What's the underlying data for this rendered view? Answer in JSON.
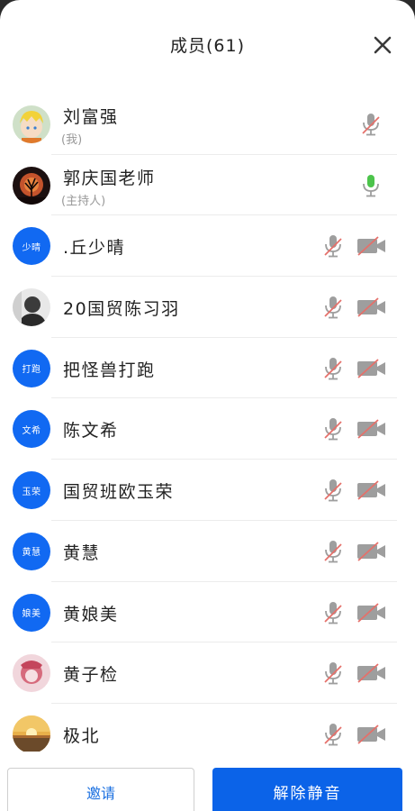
{
  "header": {
    "title": "成员(61)"
  },
  "members": [
    {
      "name": "刘富强",
      "sub": "(我)",
      "avatar_type": "image",
      "avatar_image": "anime-avatar",
      "mic": "muted",
      "show_camera": false
    },
    {
      "name": "郭庆国老师",
      "sub": "(主持人)",
      "avatar_type": "image",
      "avatar_image": "tree-sunset-avatar",
      "mic": "on",
      "show_camera": false
    },
    {
      "name": ".丘少晴",
      "sub": "",
      "avatar_type": "text",
      "avatar_text": "少晴",
      "mic": "muted",
      "show_camera": true
    },
    {
      "name": "20国贸陈习羽",
      "sub": "",
      "avatar_type": "image",
      "avatar_image": "person-photo-avatar",
      "mic": "muted",
      "show_camera": true
    },
    {
      "name": "把怪兽打跑",
      "sub": "",
      "avatar_type": "text",
      "avatar_text": "打跑",
      "mic": "muted",
      "show_camera": true
    },
    {
      "name": "陈文希",
      "sub": "",
      "avatar_type": "text",
      "avatar_text": "文希",
      "mic": "muted",
      "show_camera": true
    },
    {
      "name": "国贸班欧玉荣",
      "sub": "",
      "avatar_type": "text",
      "avatar_text": "玉荣",
      "mic": "muted",
      "show_camera": true
    },
    {
      "name": "黄慧",
      "sub": "",
      "avatar_type": "text",
      "avatar_text": "黄慧",
      "mic": "muted",
      "show_camera": true
    },
    {
      "name": "黄娘美",
      "sub": "",
      "avatar_type": "text",
      "avatar_text": "娘美",
      "mic": "muted",
      "show_camera": true
    },
    {
      "name": "黄子检",
      "sub": "",
      "avatar_type": "image",
      "avatar_image": "pink-character-avatar",
      "mic": "muted",
      "show_camera": true
    },
    {
      "name": "极北",
      "sub": "",
      "avatar_type": "image",
      "avatar_image": "sunset-avatar",
      "mic": "muted",
      "show_camera": true
    }
  ],
  "footer": {
    "invite_label": "邀请",
    "unmute_all_label": "解除静音"
  },
  "colors": {
    "accent": "#0b63e8",
    "muted_slash": "#e5706a",
    "mic_on": "#4cc44b",
    "text_avatar_bg": "#1169f2"
  }
}
